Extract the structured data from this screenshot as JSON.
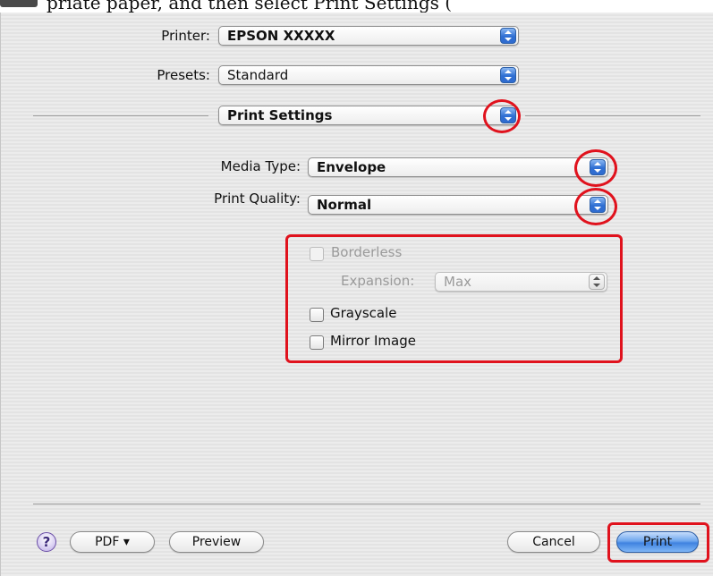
{
  "header": {
    "text": "priate paper, and then select Print Settings (",
    "icon": "dark-step-icon"
  },
  "printer": {
    "label": "Printer:",
    "value": "EPSON XXXXX"
  },
  "presets": {
    "label": "Presets:",
    "value": "Standard"
  },
  "panel": {
    "value": "Print Settings"
  },
  "media_type": {
    "label": "Media Type:",
    "value": "Envelope"
  },
  "print_quality": {
    "label": "Print Quality:",
    "value": "Normal"
  },
  "options": {
    "borderless": {
      "label": "Borderless",
      "checked": false,
      "enabled": false
    },
    "expansion": {
      "label": "Expansion:",
      "value": "Max",
      "enabled": false
    },
    "grayscale": {
      "label": "Grayscale",
      "checked": false
    },
    "mirror_image": {
      "label": "Mirror Image",
      "checked": false
    }
  },
  "footer": {
    "help": "?",
    "pdf": "PDF ▾",
    "preview": "Preview",
    "cancel": "Cancel",
    "print": "Print"
  },
  "colors": {
    "highlight": "#e0121d",
    "popup_arrow_blue": "#2f6fd3",
    "dialog_bg": "#e8e8e8"
  }
}
